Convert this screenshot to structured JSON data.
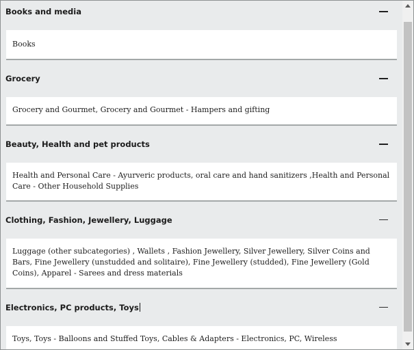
{
  "sections": [
    {
      "title": "Books and media",
      "body": "Books"
    },
    {
      "title": "Grocery",
      "body": "Grocery and Gourmet, Grocery and Gourmet - Hampers and gifting"
    },
    {
      "title": "Beauty, Health and pet products",
      "body": "Health and Personal Care - Ayurveric products, oral care and hand sanitizers ,Health and Personal Care - Other Household Supplies"
    },
    {
      "title": "Clothing, Fashion, Jewellery, Luggage",
      "body": "Luggage (other subcategories) , Wallets , Fashion Jewellery, Silver Jewellery, Silver Coins and Bars, Fine Jewellery (unstudded and solitaire), Fine Jewellery (studded), Fine Jewellery (Gold Coins), Apparel - Sarees and dress materials"
    },
    {
      "title": "Electronics, PC products, Toys",
      "body": "Toys, Toys - Balloons and Stuffed Toys, Cables & Adapters - Electronics, PC, Wireless"
    }
  ],
  "icons": {
    "collapse": "minus-icon",
    "scroll_up": "arrow-up-icon",
    "scroll_down": "arrow-down-icon"
  }
}
